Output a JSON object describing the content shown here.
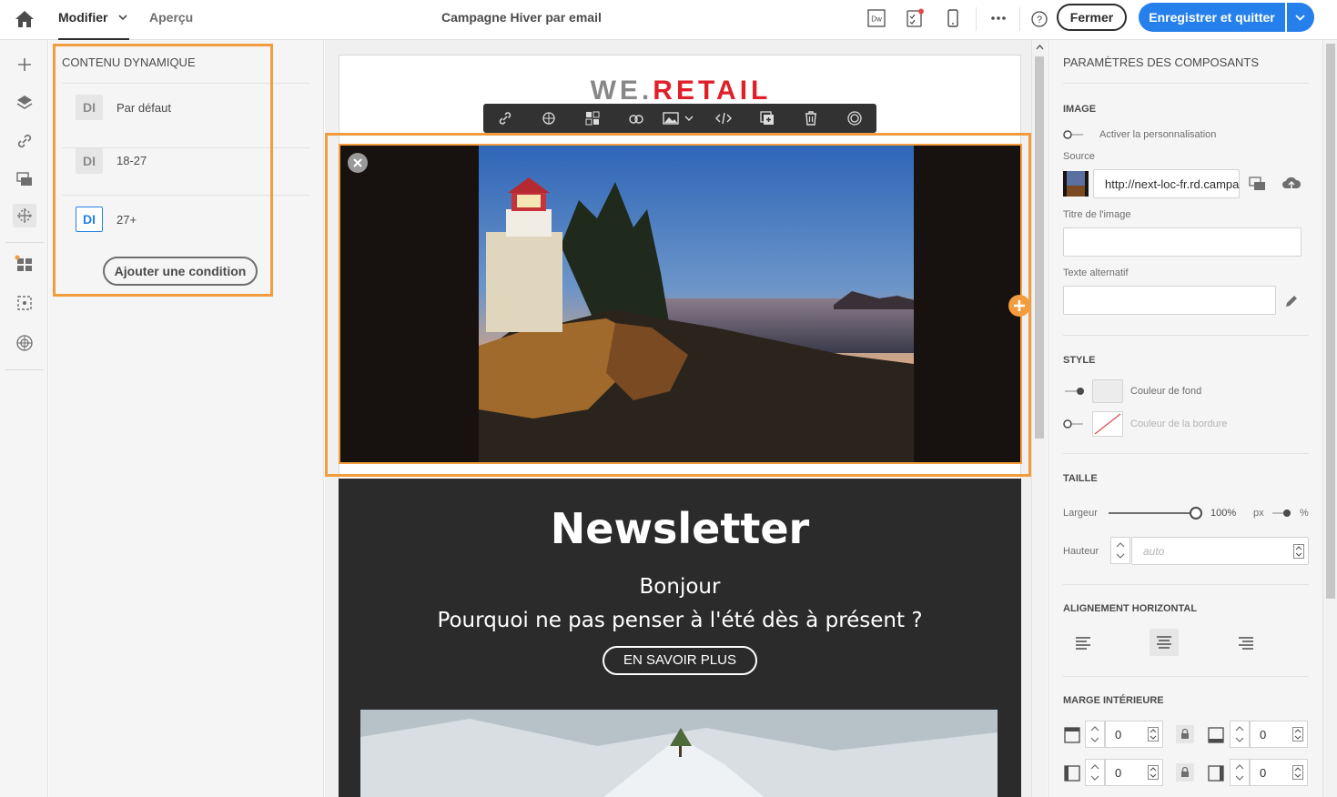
{
  "topbar": {
    "tab_modifier": "Modifier",
    "tab_apercu": "Aperçu",
    "campaign_title": "Campagne Hiver par email",
    "close_label": "Fermer",
    "save_label": "Enregistrer et quitter",
    "dreamweaver_label": "Dw"
  },
  "left_panel": {
    "title": "CONTENU DYNAMIQUE",
    "items": [
      {
        "badge": "DI",
        "label": "Par défaut"
      },
      {
        "badge": "DI",
        "label": "18-27"
      },
      {
        "badge": "DI",
        "label": "27+"
      }
    ],
    "add_condition": "Ajouter une condition"
  },
  "email": {
    "logo_we": "WE.",
    "logo_retail": "RETAIL",
    "newsletter_title": "Newsletter",
    "greeting": "Bonjour",
    "subtitle": "Pourquoi ne pas penser à l'été dès à présent ?",
    "cta": "EN SAVOIR PLUS"
  },
  "right_panel": {
    "title": "PARAMÈTRES DES COMPOSANTS",
    "image_section": "IMAGE",
    "personalize_label": "Activer la personnalisation",
    "source_label": "Source",
    "source_value": "http://next-loc-fr.rd.campa",
    "image_title_label": "Titre de l'image",
    "alt_text_label": "Texte alternatif",
    "style_section": "STYLE",
    "bg_color_label": "Couleur de fond",
    "border_color_label": "Couleur de la bordure",
    "size_section": "TAILLE",
    "width_label": "Largeur",
    "width_value": "100%",
    "unit_px": "px",
    "unit_pct": "%",
    "height_label": "Hauteur",
    "height_placeholder": "auto",
    "halign_section": "ALIGNEMENT HORIZONTAL",
    "padding_section": "MARGE INTÉRIEURE",
    "padding_top": "0",
    "padding_bottom": "0",
    "padding_left": "0",
    "padding_right": "0"
  },
  "colors": {
    "accent": "#2680eb",
    "selection": "#f29c3d",
    "logo_red": "#e01f2a"
  }
}
